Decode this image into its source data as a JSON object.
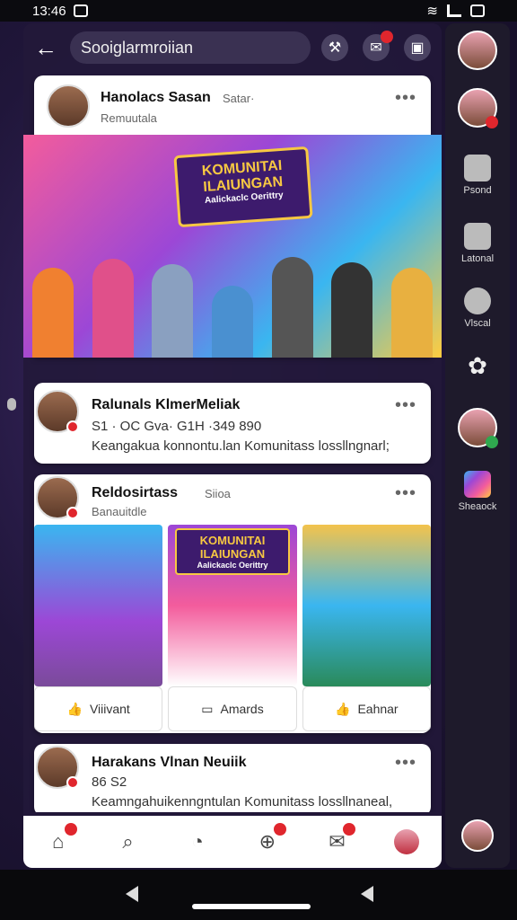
{
  "status_bar": {
    "time": "13:46",
    "left_icon": "notification-icon",
    "right_icons": [
      "wifi-icon",
      "signal-icon",
      "battery-icon"
    ]
  },
  "top_bar": {
    "search_text": "Sooiglarmroiian",
    "icons": [
      "tool-icon",
      "messenger-icon",
      "menu-icon"
    ]
  },
  "posts": [
    {
      "name": "Hanolacs Sasan",
      "extra": "Satar·",
      "subtitle": "Remuutala",
      "image_title": "KOMUNITAI ILAIUNGAN",
      "image_subtitle": "Aalickaclc Oerittry"
    },
    {
      "name": "Ralunals KlmerMeliak",
      "meta": "S1 · OC Gva· G1H ·349 890",
      "text": "Keangakua konnontu.lan Komunitass lossllngnarl;"
    },
    {
      "name": "Reldosirtass",
      "extra": "Siioa",
      "subtitle": "Banauitdle",
      "image_title": "KOMUNITAI ILAIUNGAN",
      "image_subtitle": "Aalickaclc Oerittry",
      "actions": [
        "Viiivant",
        "Amards",
        "Eahnar"
      ]
    },
    {
      "name": "Harakans Vlnan Neuiik",
      "meta": "86 S2",
      "text": "Keamngahuikenngntulan Komunitass lossllnaneal,"
    }
  ],
  "bottom_nav": [
    "home-icon",
    "search-icon",
    "clock-icon",
    "add-icon",
    "messages-icon",
    "profile-icon"
  ],
  "sidebar": [
    {
      "type": "avatar"
    },
    {
      "type": "avatar"
    },
    {
      "label": "Psond",
      "icon": "person-icon"
    },
    {
      "label": "Latonal",
      "icon": "checkbox-icon"
    },
    {
      "label": "Vlscal",
      "icon": "gauge-icon"
    },
    {
      "label": "",
      "icon": "flower-icon"
    },
    {
      "type": "avatar"
    },
    {
      "label": "Sheaock",
      "icon": "gradient-app-icon"
    },
    {
      "type": "avatar"
    }
  ],
  "colors": {
    "accent_red": "#e0262d",
    "background": "#1b1430",
    "card": "#ffffff"
  }
}
